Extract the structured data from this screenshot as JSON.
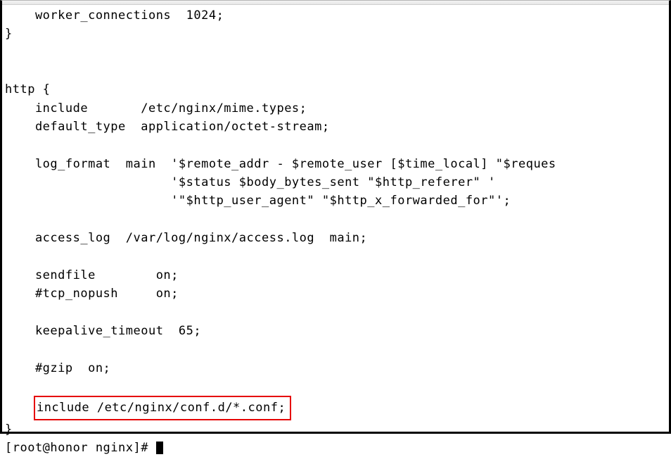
{
  "config": {
    "line_worker": "    worker_connections  1024;",
    "line_close1": "}",
    "line_blank1": "",
    "line_blank2": "",
    "line_http": "http {",
    "line_include": "    include       /etc/nginx/mime.types;",
    "line_deftype": "    default_type  application/octet-stream;",
    "line_blank3": "",
    "line_log1": "    log_format  main  '$remote_addr - $remote_user [$time_local] \"$reques",
    "line_log2": "                      '$status $body_bytes_sent \"$http_referer\" '",
    "line_log3": "                      '\"$http_user_agent\" \"$http_x_forwarded_for\"';",
    "line_blank4": "",
    "line_access": "    access_log  /var/log/nginx/access.log  main;",
    "line_blank5": "",
    "line_sendf": "    sendfile        on;",
    "line_tcp": "    #tcp_nopush     on;",
    "line_blank6": "",
    "line_keep": "    keepalive_timeout  65;",
    "line_blank7": "",
    "line_gzip": "    #gzip  on;",
    "line_blank8": "",
    "line_hl_pad": "    ",
    "line_hl_text": "include /etc/nginx/conf.d/*.conf;",
    "line_close2": "}"
  },
  "prompt": {
    "text": "[root@honor nginx]# "
  }
}
